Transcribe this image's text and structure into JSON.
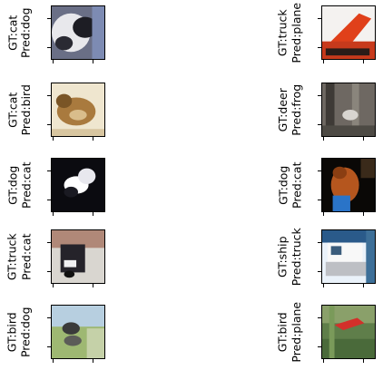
{
  "panels": [
    {
      "gt": "GT:cat",
      "pred": "Pred:dog",
      "col": 0,
      "row": 0,
      "image": "blurry cat face close-up"
    },
    {
      "gt": "GT:truck",
      "pred": "Pred:plane",
      "col": 1,
      "row": 0,
      "image": "red truck"
    },
    {
      "gt": "GT:cat",
      "pred": "Pred:bird",
      "col": 0,
      "row": 1,
      "image": "tabby cat lying"
    },
    {
      "gt": "GT:deer",
      "pred": "Pred:frog",
      "col": 1,
      "row": 1,
      "image": "deer in forest"
    },
    {
      "gt": "GT:dog",
      "pred": "Pred:cat",
      "col": 0,
      "row": 2,
      "image": "black and white dog"
    },
    {
      "gt": "GT:dog",
      "pred": "Pred:cat",
      "col": 1,
      "row": 2,
      "image": "brown dog with blue"
    },
    {
      "gt": "GT:truck",
      "pred": "Pred:cat",
      "col": 0,
      "row": 3,
      "image": "dark truck"
    },
    {
      "gt": "GT:ship",
      "pred": "Pred:truck",
      "col": 1,
      "row": 3,
      "image": "white ship/truck"
    },
    {
      "gt": "GT:bird",
      "pred": "Pred:dog",
      "col": 0,
      "row": 4,
      "image": "bird on grass"
    },
    {
      "gt": "GT:bird",
      "pred": "Pred:plane",
      "col": 1,
      "row": 4,
      "image": "red bird in green"
    }
  ],
  "colors": {
    "axis": "#000000",
    "background": "#ffffff"
  }
}
